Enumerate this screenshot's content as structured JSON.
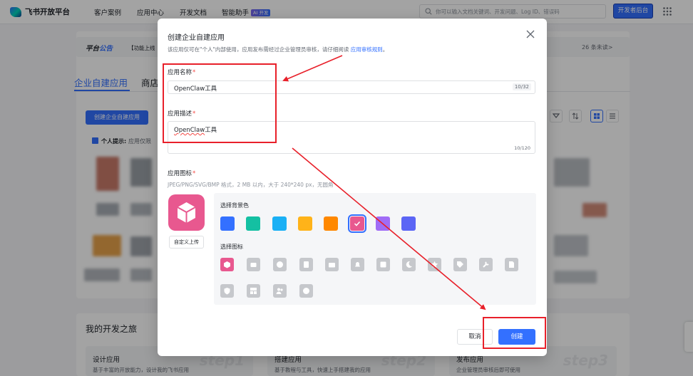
{
  "topnav": {
    "logo_text": "飞书开放平台",
    "items": [
      "客户案例",
      "应用中心",
      "开发文档",
      "智能助手"
    ],
    "ai_badge": "AI 开发",
    "search_placeholder": "你可以输入文档关键词、开发问题、Log ID、错误码",
    "developer_button": "开发者后台"
  },
  "notice": {
    "label_prefix": "平台",
    "label_highlight": "公告",
    "text": "【功能上线",
    "count": "26 条未读>"
  },
  "tabs": [
    "企业自建应用",
    "商店"
  ],
  "bg": {
    "create_button": "创建企业自建应用",
    "tip_title": "个人提示:",
    "tip_text": "应用仅限"
  },
  "journey": {
    "title": "我的开发之旅",
    "cards": [
      {
        "title": "设计应用",
        "desc": "基于丰富的开放能力，设计我的飞书应用",
        "step": "step1"
      },
      {
        "title": "搭建应用",
        "desc": "基于教程与工具，快速上手搭建我的应用",
        "step": "step2"
      },
      {
        "title": "发布应用",
        "desc": "企业管理员审核后即可使用",
        "step": "step3"
      }
    ]
  },
  "modal": {
    "title": "创建企业自建应用",
    "subtitle": "该应用仅可在\"个人\"内部使用，应用发布需经过企业管理员审核，请仔细阅读",
    "subtitle_link": "应用审核规则",
    "subtitle_end": "。",
    "name_label": "应用名称",
    "name_value": "OpenClaw工具",
    "name_count": "10/32",
    "desc_label": "应用描述",
    "desc_value_a": "OpenClaw",
    "desc_value_b": "工具",
    "desc_count": "10/120",
    "icon_label": "应用图标",
    "icon_hint": "JPEG/PNG/SVG/BMP 格式，2 MB 以内，大于 240*240 px，无圆角",
    "upload_button": "自定义上传",
    "bg_color_title": "选择背景色",
    "icon_title": "选择图标",
    "colors": [
      "#3370ff",
      "#14c0a2",
      "#1ab0f5",
      "#ffb319",
      "#ff8800",
      "#e8588f",
      "#a06cf6",
      "#5b65f5"
    ],
    "selected_color_index": 5,
    "cancel_button": "取消",
    "create_button": "创建"
  }
}
